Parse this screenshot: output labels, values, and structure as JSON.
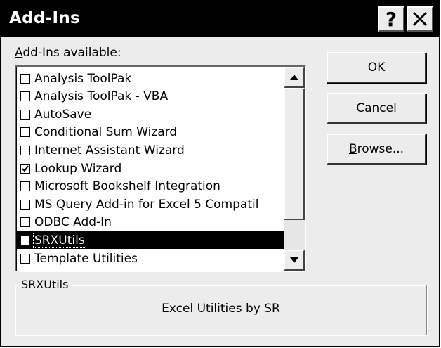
{
  "window": {
    "title": "Add-Ins",
    "help_icon": "?",
    "close_icon": "close-icon"
  },
  "list": {
    "label_underlined": "A",
    "label_rest": "dd-Ins available:",
    "items": [
      {
        "label": "Analysis ToolPak",
        "checked": false,
        "selected": false
      },
      {
        "label": "Analysis ToolPak - VBA",
        "checked": false,
        "selected": false
      },
      {
        "label": "AutoSave",
        "checked": false,
        "selected": false
      },
      {
        "label": "Conditional Sum Wizard",
        "checked": false,
        "selected": false
      },
      {
        "label": "Internet Assistant Wizard",
        "checked": false,
        "selected": false
      },
      {
        "label": "Lookup Wizard",
        "checked": true,
        "selected": false
      },
      {
        "label": "Microsoft Bookshelf Integration",
        "checked": false,
        "selected": false
      },
      {
        "label": "MS Query Add-in for Excel 5 Compatil",
        "checked": false,
        "selected": false
      },
      {
        "label": "ODBC Add-In",
        "checked": false,
        "selected": false
      },
      {
        "label": "SRXUtils",
        "checked": false,
        "selected": true
      },
      {
        "label": "Template Utilities",
        "checked": false,
        "selected": false
      }
    ]
  },
  "buttons": {
    "ok": "OK",
    "cancel": "Cancel",
    "browse_underlined": "B",
    "browse_rest": "rowse..."
  },
  "details": {
    "title": "SRXUtils",
    "description": "Excel Utilities by SR"
  },
  "colors": {
    "selection_bg": "#000000",
    "dialog_bg": "#ececec",
    "titlebar_bg": "#000000"
  }
}
